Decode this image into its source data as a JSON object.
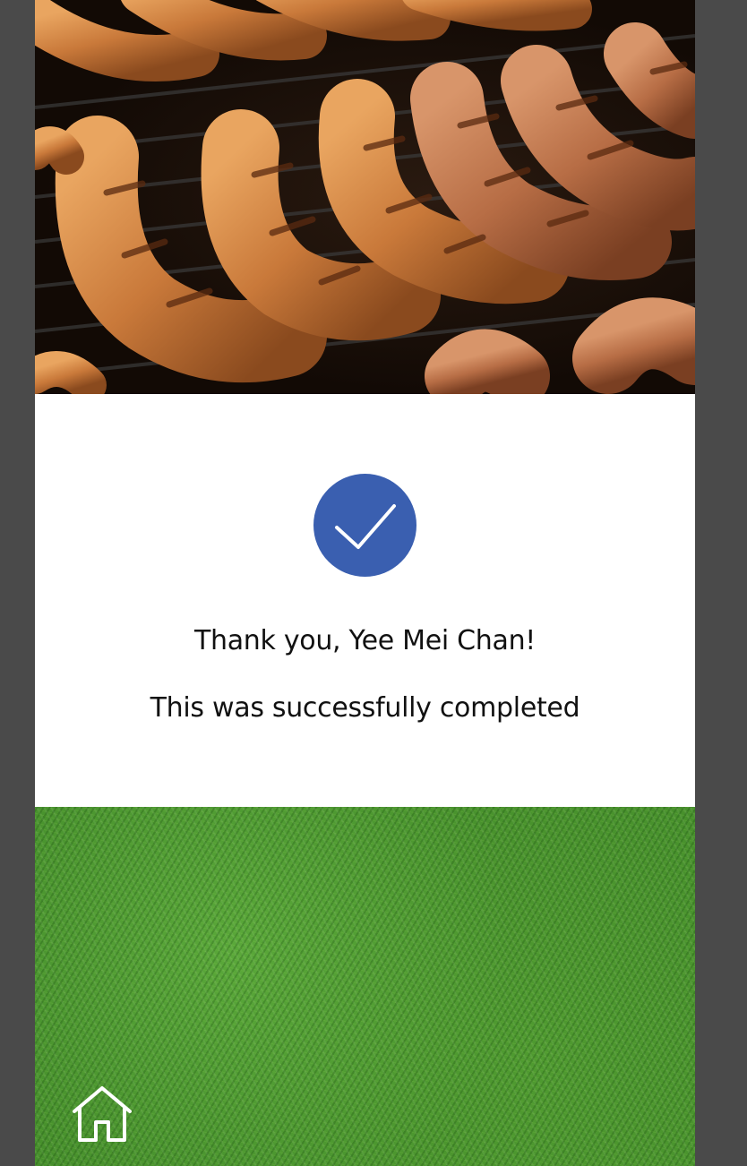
{
  "confirmation": {
    "thank_you": "Thank you, Yee Mei Chan!",
    "message": "This was successfully completed"
  },
  "colors": {
    "check_circle": "#3a5fb0",
    "background_side": "#4a4a4a",
    "grass": "#468f2c"
  },
  "icons": {
    "check": "check-icon",
    "home": "home-icon"
  }
}
